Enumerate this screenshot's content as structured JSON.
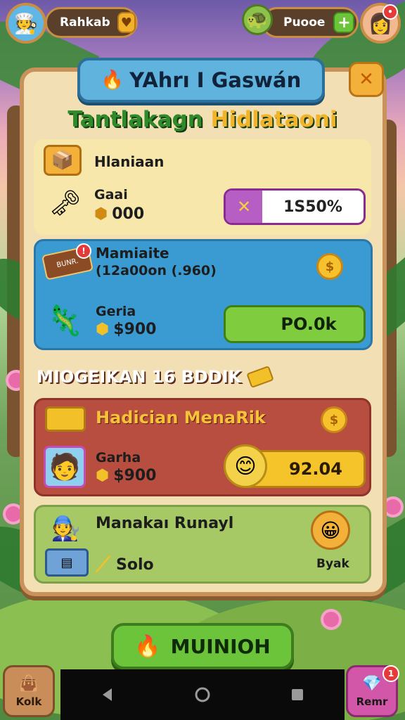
{
  "top_bar": {
    "left_name": "Rahkab",
    "left_btn_icon": "heart-arrow-icon",
    "right_name": "Puooe",
    "right_btn": "+"
  },
  "panel": {
    "title": "YAhrı I Gaswán",
    "subtitle_main": "Tantlakagn",
    "subtitle_accent": "Hidlataoni",
    "close": "✕"
  },
  "cards": {
    "c1": {
      "label": "Hlaniaan",
      "sub": "Gaai",
      "value": "000",
      "bar_x": "✕",
      "bar_text": "1S50%"
    },
    "c2": {
      "label": "Mamiaite",
      "sub_label": "(12a00on (.960)",
      "sub": "Geria",
      "value": "$900",
      "bar_text": "PO.0k",
      "tag": "BUNR."
    },
    "c3": {
      "title": "Hadician MenaRik",
      "sub": "Garha",
      "value": "$900",
      "bar_text": "92.04"
    },
    "c4": {
      "title": "Manakaı Runayl",
      "value": "Solo",
      "bar_text": "Byak"
    }
  },
  "section": {
    "heading": "MIOGEIKAN 16 BDDIK"
  },
  "main_button": {
    "label": "MUINIOH"
  },
  "corners": {
    "left": "Kolk",
    "right": "Remr",
    "right_badge": "1"
  },
  "coin_symbol": "$",
  "colors": {
    "panel": "#f3dfb4",
    "blue_card": "#3a9bd3",
    "red_card": "#b84e3f",
    "green_card": "#a6c865",
    "accent_green": "#6cc43a",
    "accent_gold": "#f2b12a"
  }
}
